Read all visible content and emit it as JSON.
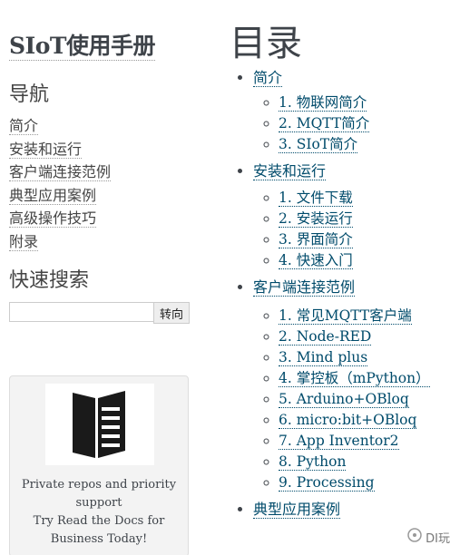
{
  "sidebar": {
    "project_title": "SIoT使用手册",
    "nav_heading": "导航",
    "nav_items": [
      {
        "label": "简介"
      },
      {
        "label": "安装和运行"
      },
      {
        "label": "客户端连接范例"
      },
      {
        "label": "典型应用案例"
      },
      {
        "label": "高级操作技巧"
      },
      {
        "label": "附录"
      }
    ],
    "search_heading": "快速搜索",
    "search": {
      "value": "",
      "button_label": "转向"
    },
    "ad": {
      "line1": "Private repos and priority",
      "line2": "support",
      "line3": "Try Read the Docs for",
      "line4": "Business Today!",
      "icon": "open-book-icon"
    }
  },
  "main": {
    "title": "目录",
    "sections": [
      {
        "label": "简介",
        "items": [
          "1. 物联网简介",
          "2. MQTT简介",
          "3. SIoT简介"
        ]
      },
      {
        "label": "安装和运行",
        "items": [
          "1. 文件下载",
          "2. 安装运行",
          "3. 界面简介",
          "4. 快速入门"
        ]
      },
      {
        "label": "客户端连接范例",
        "items": [
          "1. 常见MQTT客户端",
          "2. Node-RED",
          "3. Mind plus",
          "4. 掌控板（mPython）",
          "5. Arduino+OBloq",
          "6. micro:bit+OBloq",
          "7. App Inventor2",
          "8. Python",
          "9. Processing"
        ]
      },
      {
        "label": "典型应用案例",
        "items": []
      }
    ]
  },
  "watermark": {
    "text": "DI玩"
  },
  "colors": {
    "link": "#004b6b",
    "text": "#3e4349"
  }
}
